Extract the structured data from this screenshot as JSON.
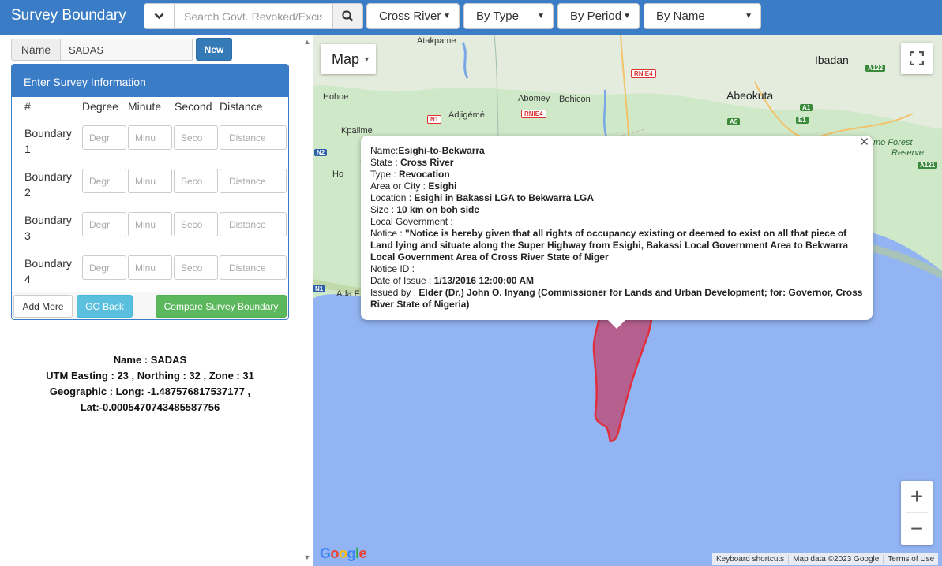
{
  "header": {
    "title": "Survey Boundary",
    "search_placeholder": "Search Govt. Revoked/Excis",
    "filters": {
      "state": "Cross River",
      "type": "By Type",
      "period": "By Period",
      "name": "By Name"
    }
  },
  "form": {
    "name_label": "Name",
    "name_value": "SADAS",
    "new_label": "New",
    "panel_title": "Enter Survey Information",
    "columns": [
      "#",
      "Degree",
      "Minute",
      "Second",
      "Distance"
    ],
    "rows": [
      {
        "label": "Boundary 1",
        "degree": "Degr",
        "minute": "Minu",
        "second": "Seco",
        "distance": "Distance"
      },
      {
        "label": "Boundary 2",
        "degree": "Degr",
        "minute": "Minu",
        "second": "Seco",
        "distance": "Distance"
      },
      {
        "label": "Boundary 3",
        "degree": "Degr",
        "minute": "Minu",
        "second": "Seco",
        "distance": "Distance"
      },
      {
        "label": "Boundary 4",
        "degree": "Degr",
        "minute": "Minu",
        "second": "Seco",
        "distance": "Distance"
      }
    ],
    "buttons": {
      "add_more": "Add More",
      "go_back": "GO Back",
      "compare": "Compare Survey Boundary"
    }
  },
  "summary": {
    "name_line": "Name : SADAS",
    "utm_line": "UTM Easting : 23 , Northing : 32 , Zone : 31",
    "geo_line": "Geographic : Long: -1.487576817537177 ,",
    "lat_line": "Lat:-0.0005470743485587756"
  },
  "map": {
    "type_label": "Map",
    "google_logo": "Google",
    "attribution": [
      "Keyboard shortcuts",
      "Map data ©2023 Google",
      "Terms of Use"
    ],
    "places": {
      "atakpame": "Atakpame",
      "ibadan": "Ibadan",
      "hohoe": "Hohoe",
      "abomey": "Abomey",
      "bohicon": "Bohicon",
      "abeokuta": "Abeokuta",
      "adjigeme": "Adjigémé",
      "kpalime": "Kpalime",
      "ho": "Ho",
      "ada": "Ada F",
      "forest": "mo Forest",
      "reserve": "Reserve"
    },
    "roads": {
      "rnie4_a": "RNIE4",
      "rnie4_b": "RNIE4",
      "n1_a": "N1",
      "n1_b": "N1",
      "n2": "N2",
      "a122": "A122",
      "a121": "A121",
      "a1": "A1",
      "a5": "A5",
      "e1": "E1"
    },
    "popup": {
      "name_key": "Name:",
      "name": "Esighi-to-Bekwarra",
      "state_key": "State : ",
      "state": "Cross River",
      "type_key": "Type : ",
      "type": "Revocation",
      "area_key": "Area or City : ",
      "area": "Esighi",
      "location_key": "Location : ",
      "location": "Esighi in Bakassi LGA to Bekwarra LGA",
      "size_key": "Size : ",
      "size": "10 km on boh side",
      "lg_key": "Local Government : ",
      "lg": "",
      "notice_key": "Notice : ",
      "notice": "\"Notice is hereby given that all rights of occupancy existing or deemed to exist on all that piece of Land lying and situate along the Super Highway from Esighi, Bakassi Local Government Area to Bekwarra Local Government Area of Cross River State of Niger",
      "notice_id_key": "Notice ID : ",
      "notice_id": "",
      "date_key": "Date of Issue : ",
      "date": "1/13/2016 12:00:00 AM",
      "issued_key": "Issued by : ",
      "issued": "Elder (Dr.) John O. Inyang (Commissioner for Lands and Urban Development; for: Governor, Cross River State of Nigeria)"
    }
  }
}
